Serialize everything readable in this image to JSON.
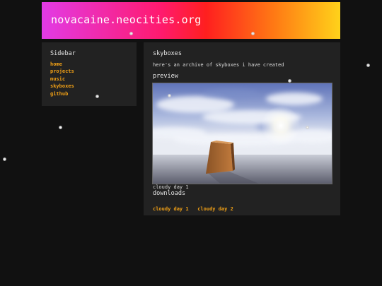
{
  "header": {
    "site_title": "novacaine.neocities.org"
  },
  "sidebar": {
    "title": "Sidebar",
    "links": [
      {
        "label": "home"
      },
      {
        "label": "projects"
      },
      {
        "label": "music"
      },
      {
        "label": "skyboxes"
      },
      {
        "label": "github"
      }
    ]
  },
  "main": {
    "title": "skyboxes",
    "intro": "here's an archive of skyboxes i have created",
    "preview_heading": "preview",
    "preview_caption": "cloudy day 1",
    "downloads_heading": "downloads",
    "downloads": [
      {
        "label": "cloudy day 1"
      },
      {
        "label": "cloudy day 2"
      }
    ]
  },
  "colors": {
    "background": "#111111",
    "panel": "#222222",
    "link": "#f2a116",
    "header_gradient": [
      "#e23be6",
      "#ff1f1f",
      "#ffd21a"
    ]
  }
}
